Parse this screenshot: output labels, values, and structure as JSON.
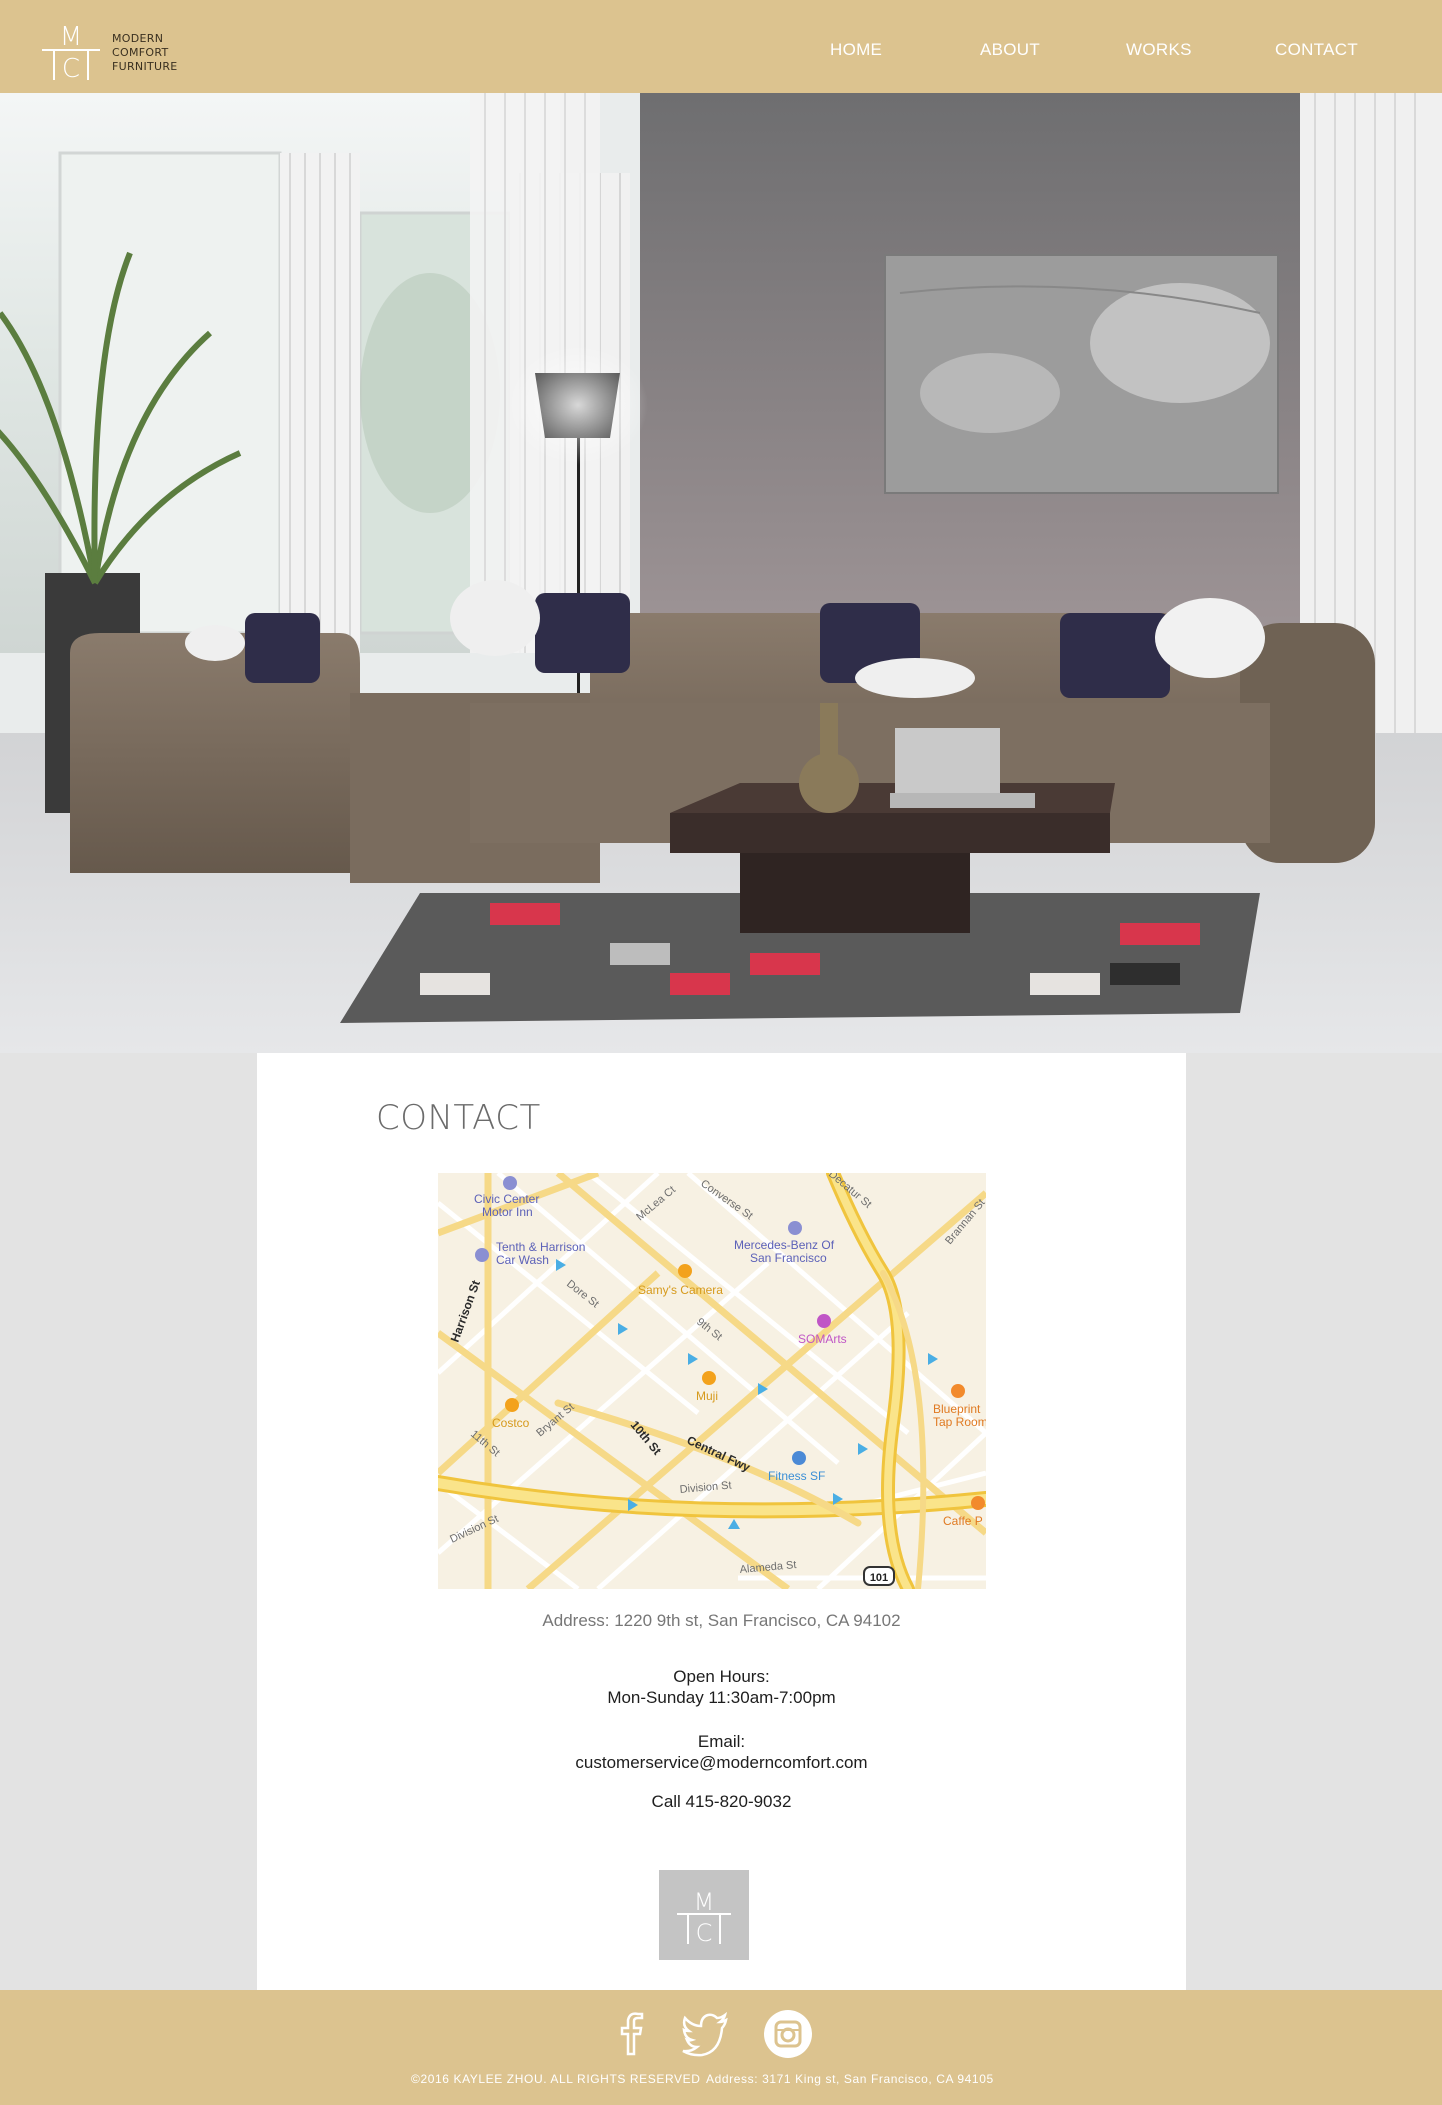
{
  "brand": {
    "mark_top": "M",
    "mark_bottom": "C",
    "line1": "MODERN",
    "line2": "COMFORT",
    "line3": "FURNITURE"
  },
  "nav": [
    {
      "label": "HOME"
    },
    {
      "label": "ABOUT"
    },
    {
      "label": "WORKS"
    },
    {
      "label": "CONTACT"
    }
  ],
  "contact": {
    "title": "CONTACT",
    "address": "Address: 1220 9th st, San Francisco,  CA  94102",
    "hours_label": "Open Hours:",
    "hours_value": "Mon-Sunday 11:30am-7:00pm",
    "email_label": "Email:",
    "email_value": "customerservice@moderncomfort.com",
    "phone": "Call 415-820-9032"
  },
  "map": {
    "labels": {
      "civic1": "Civic Center",
      "civic2": "Motor Inn",
      "tenth1": "Tenth & Harrison",
      "tenth2": "Car Wash",
      "samys": "Samy's Camera",
      "merc1": "Mercedes-Benz Of",
      "merc2": "San Francisco",
      "somarts": "SOMArts",
      "muji": "Muji",
      "costco": "Costco",
      "blue1": "Blueprint",
      "blue2": "Tap Room",
      "fitness": "Fitness SF",
      "caffe": "Caffe P",
      "mclea": "McLea Ct",
      "converse": "Converse St",
      "decatur": "Decatur St",
      "dore": "Dore St",
      "ninth": "9th St",
      "harrison": "Harrison St",
      "bryant": "Bryant St",
      "tenthst": "10th St",
      "central": "Central Fwy",
      "eleventh": "11th St",
      "division1": "Division St",
      "division2": "Division St",
      "alameda": "Alameda St",
      "brannan": "Brannan St",
      "hwy": "101"
    }
  },
  "footer": {
    "copyright": "©2016 KAYLEE ZHOU.  ALL RIGHTS RESERVED",
    "address": "Address: 3171 King st, San Francisco, CA 94105"
  },
  "colors": {
    "header_bg": "#dcc38f",
    "page_bg": "#e3e3e3",
    "panel_bg": "#ffffff"
  }
}
